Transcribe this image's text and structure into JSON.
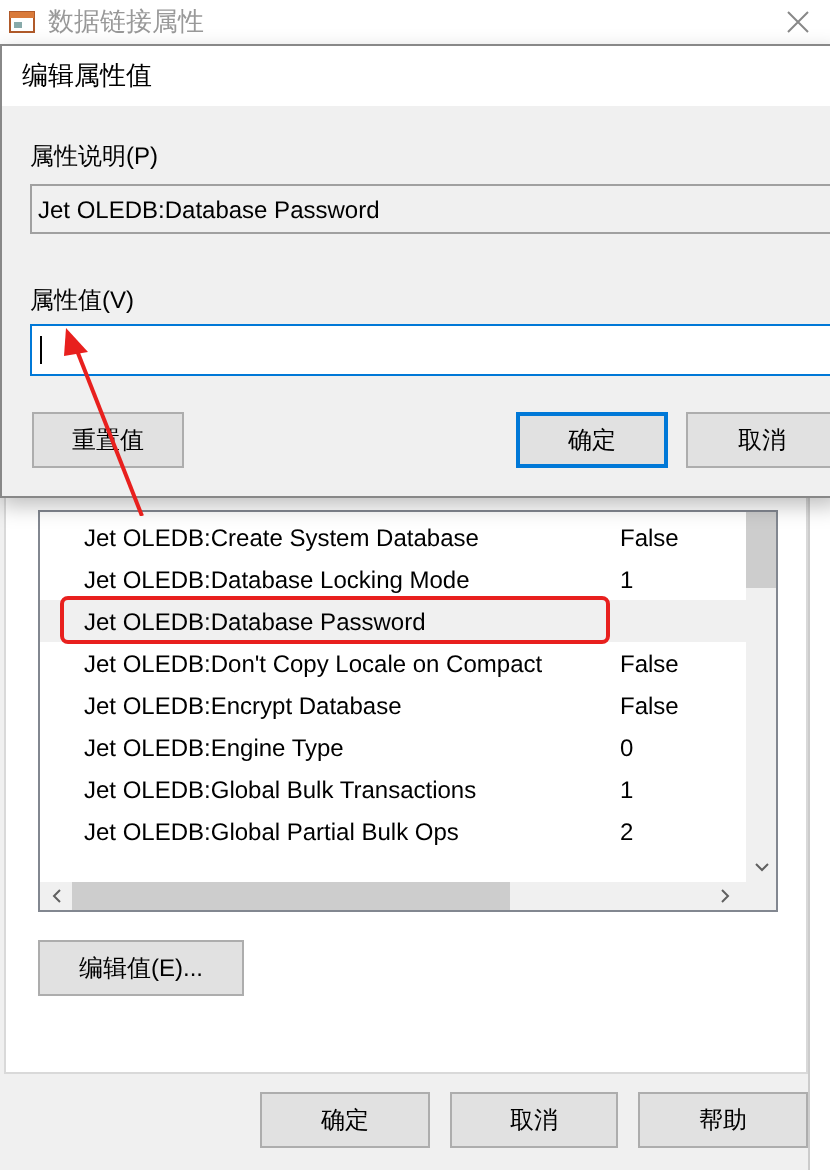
{
  "window": {
    "title": "数据链接属性"
  },
  "properties": {
    "rows": [
      {
        "name": "Jet OLEDB:Create System Database",
        "value": "False",
        "selected": false,
        "highlighted": false
      },
      {
        "name": "Jet OLEDB:Database Locking Mode",
        "value": "1",
        "selected": false,
        "highlighted": false
      },
      {
        "name": "Jet OLEDB:Database Password",
        "selected": true,
        "highlighted": true
      },
      {
        "name": "Jet OLEDB:Don't Copy Locale on Compact",
        "value": "False",
        "selected": false,
        "highlighted": false
      },
      {
        "name": "Jet OLEDB:Encrypt Database",
        "value": "False",
        "selected": false,
        "highlighted": false
      },
      {
        "name": "Jet OLEDB:Engine Type",
        "value": "0",
        "selected": false,
        "highlighted": false
      },
      {
        "name": "Jet OLEDB:Global Bulk Transactions",
        "value": "1",
        "selected": false,
        "highlighted": false
      },
      {
        "name": "Jet OLEDB:Global Partial Bulk Ops",
        "value": "2",
        "selected": false,
        "highlighted": false
      }
    ]
  },
  "edit_button": "编辑值(E)...",
  "buttons": [
    "确定",
    "取消",
    "帮助"
  ],
  "dialog": {
    "title": "编辑属性值",
    "description_label": "属性说明(P)",
    "description": "Jet OLEDB:Database Password",
    "value_label": "属性值(V)",
    "buttons": [
      {
        "label": "重置值",
        "default": false
      },
      {
        "label": "确定",
        "default": true
      },
      {
        "label": "取消",
        "default": false
      }
    ]
  }
}
